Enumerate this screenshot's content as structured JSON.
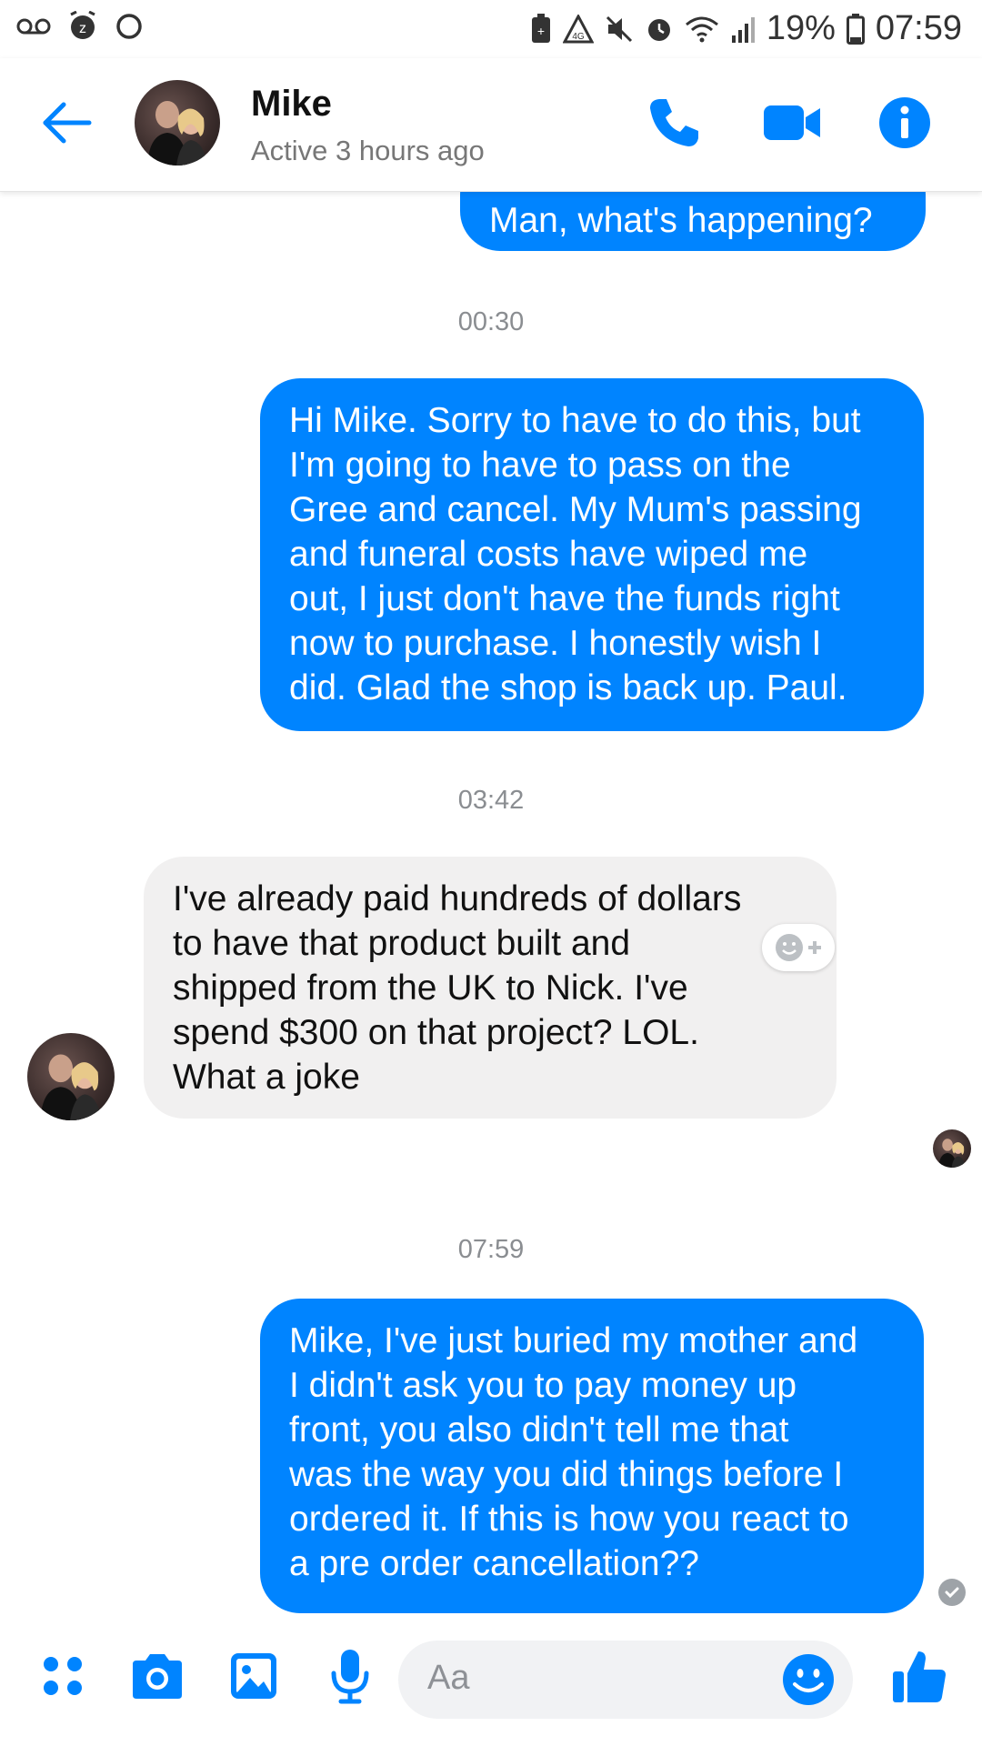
{
  "status_bar": {
    "battery": "19%",
    "time": "07:59"
  },
  "header": {
    "contact_name": "Mike",
    "contact_status": "Active 3 hours ago"
  },
  "messages": [
    {
      "sender": "me",
      "text": "Man, what's happening?"
    },
    {
      "timestamp": "00:30"
    },
    {
      "sender": "me",
      "text": "Hi Mike. Sorry to have to do this, but\nI'm going to have to pass on the\nGree and cancel. My Mum's passing\nand funeral costs have wiped me\nout, I just don't have the funds right\nnow to purchase. I honestly wish I\ndid. Glad the shop is back up. Paul."
    },
    {
      "timestamp": "03:42"
    },
    {
      "sender": "Mike",
      "text": "I've already paid hundreds of dollars\nto have that product built and\nshipped from the UK to Nick. I've\nspend $300 on that project?  LOL.\nWhat a joke"
    },
    {
      "timestamp": "07:59"
    },
    {
      "sender": "me",
      "text": "Mike, I've just buried my mother and\nI didn't ask you to pay money up\nfront, you also didn't tell me that\nwas the way you did things before I\nordered it. If this is how you react to\na pre order cancellation??"
    }
  ],
  "composer": {
    "placeholder": "Aa"
  },
  "colors": {
    "accent": "#0084ff",
    "incoming_bubble": "#f1f0f0",
    "timestamp": "#8a8d91"
  },
  "icons": {
    "status_left": [
      "voicemail-icon",
      "alarm-off-icon",
      "sync-icon"
    ],
    "status_right": [
      "battery-saver-icon",
      "warning-icon",
      "mute-icon",
      "alarm-icon",
      "wifi-icon",
      "signal-icon",
      "battery-icon"
    ],
    "header": [
      "back-arrow-icon",
      "phone-icon",
      "video-camera-icon",
      "info-icon"
    ],
    "composer": [
      "apps-icon",
      "camera-icon",
      "gallery-icon",
      "microphone-icon",
      "emoji-icon",
      "thumbs-up-icon"
    ]
  }
}
